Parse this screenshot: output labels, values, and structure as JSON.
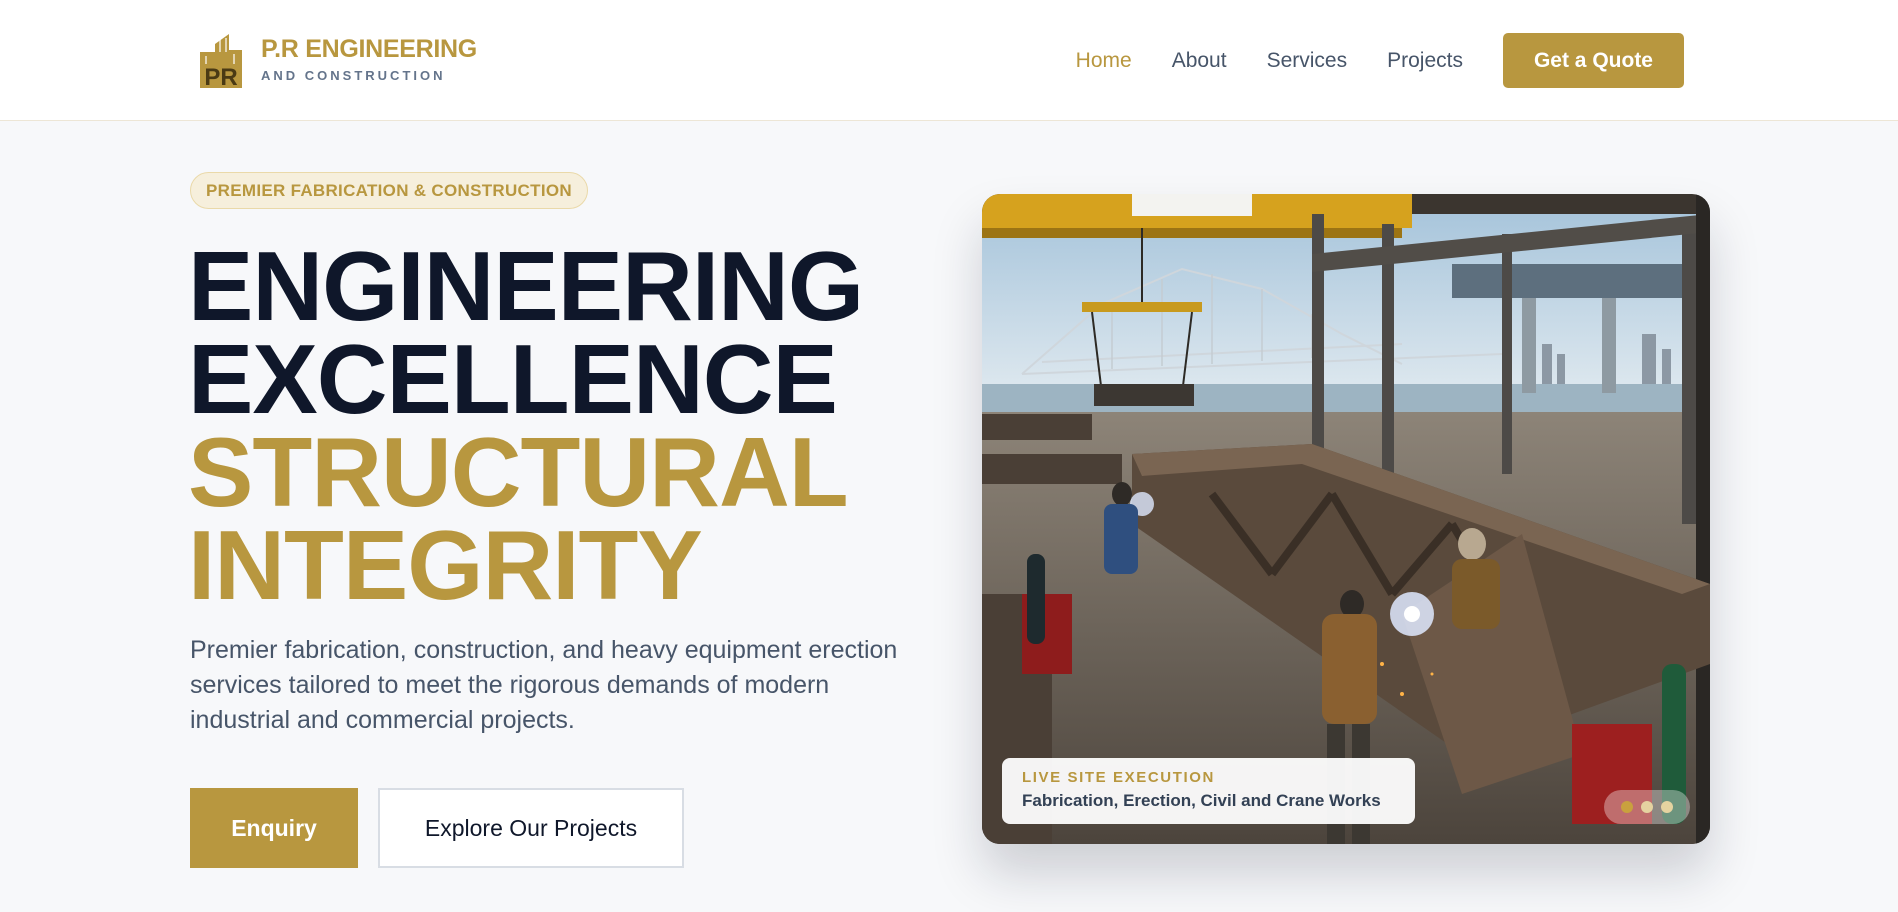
{
  "brand": {
    "name": "P.R ENGINEERING",
    "tagline": "AND CONSTRUCTION",
    "mark_text": "PR",
    "logo_icon": "building-skyline-icon"
  },
  "nav": {
    "items": [
      {
        "label": "Home",
        "active": true
      },
      {
        "label": "About",
        "active": false
      },
      {
        "label": "Services",
        "active": false
      },
      {
        "label": "Projects",
        "active": false
      }
    ],
    "cta_label": "Get a Quote"
  },
  "hero": {
    "eyebrow": "PREMIER FABRICATION & CONSTRUCTION",
    "headline": {
      "line1": "ENGINEERING",
      "line2": "EXCELLENCE",
      "line3": "STRUCTURAL",
      "line4": "INTEGRITY"
    },
    "description": "Premier fabrication, construction, and heavy equipment erection services tailored to meet the rigorous demands of modern industrial and commercial projects.",
    "primary_button": "Enquiry",
    "secondary_button": "Explore Our Projects"
  },
  "slide": {
    "image_subject": "steel-fabrication-yard-photo",
    "label": "LIVE SITE EXECUTION",
    "text": "Fabrication, Erection, Civil and Crane Works",
    "slide_count": 3,
    "active_slide": 1
  },
  "colors": {
    "accent": "#b8973f",
    "heading": "#0f172a",
    "body_text": "#475569",
    "page_bg": "#f7f8fa",
    "dot_active": "#c9a13e",
    "dot_inactive": "#e5d3a0"
  }
}
